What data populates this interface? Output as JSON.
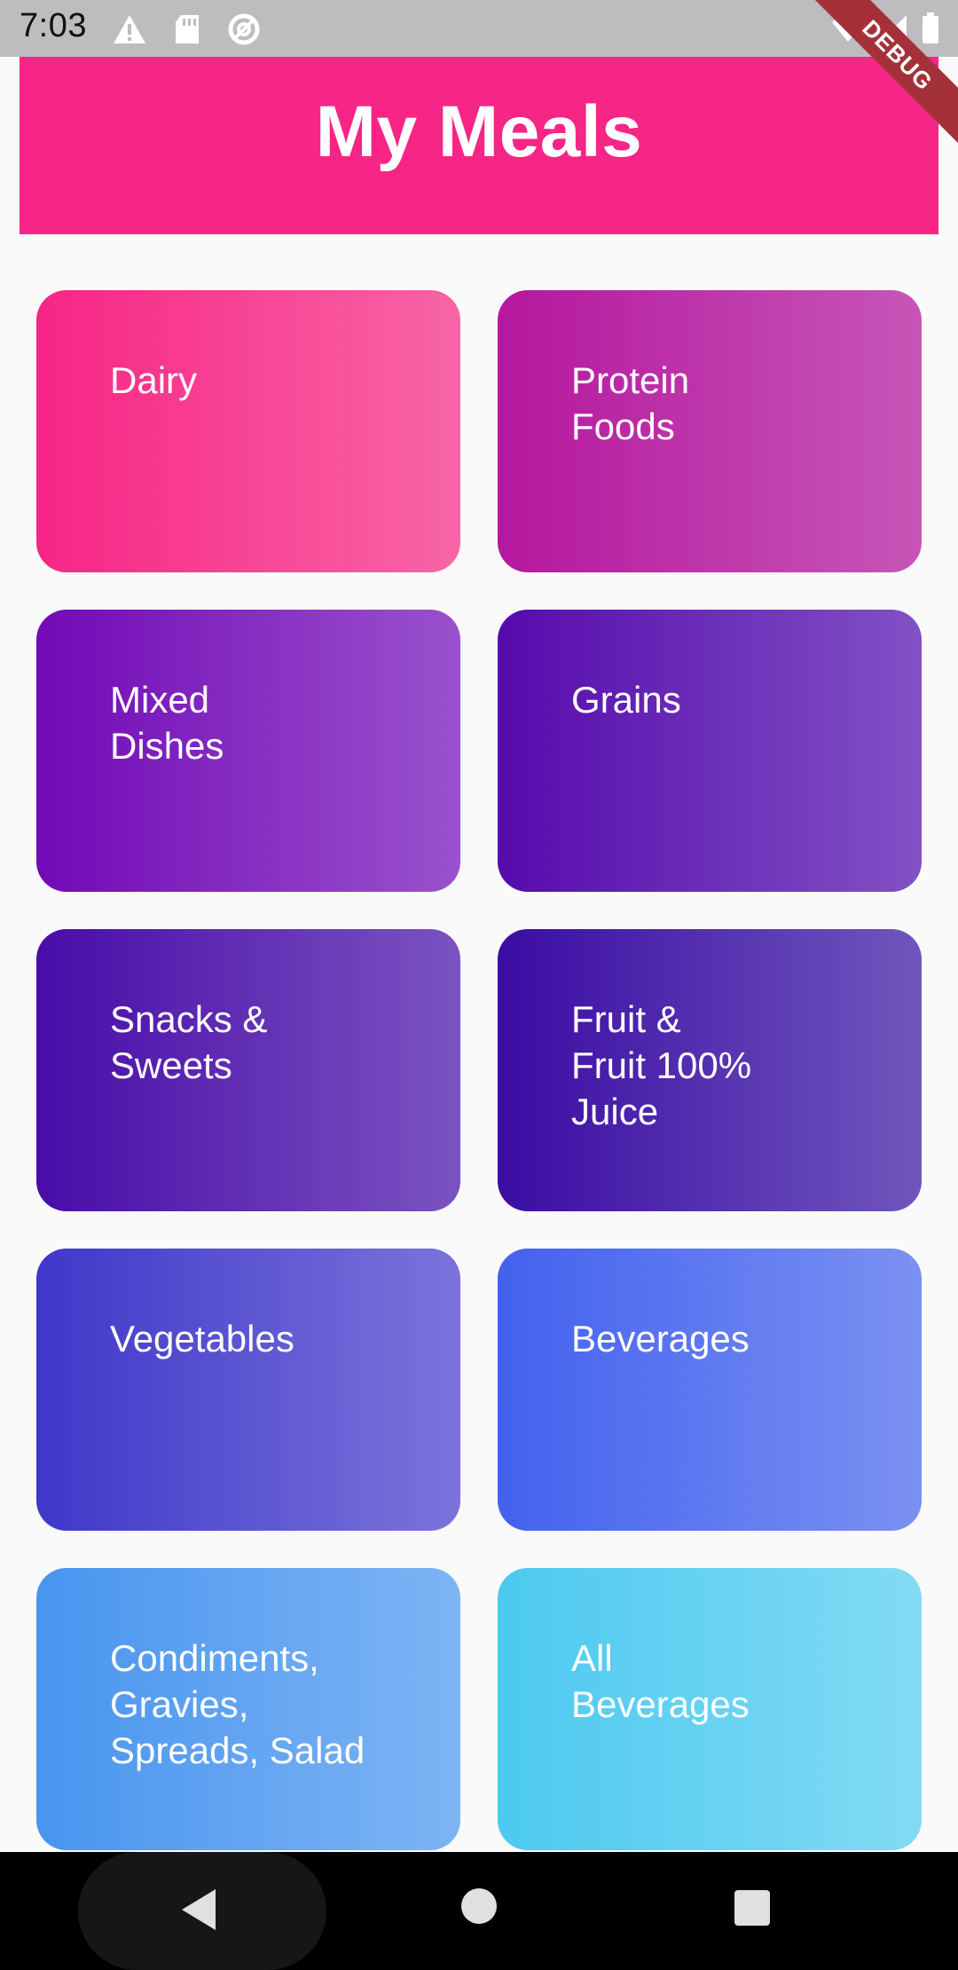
{
  "status_bar": {
    "time": "7:03",
    "icons_left": [
      "warning-icon",
      "sd-card-icon",
      "sync-icon"
    ],
    "icons_right": [
      "wifi-icon",
      "cellular-signal-icon",
      "battery-icon"
    ],
    "debug_banner": "DEBUG"
  },
  "app_bar": {
    "title": "My Meals",
    "color": "#f72585"
  },
  "categories": [
    {
      "label": "Dairy",
      "gradient": [
        "#f72585",
        "#f865a6"
      ]
    },
    {
      "label": "Protein\nFoods",
      "gradient": [
        "#b5179e",
        "#c756b7"
      ]
    },
    {
      "label": "Mixed\nDishes",
      "gradient": [
        "#7209b7",
        "#9a52cd"
      ]
    },
    {
      "label": "Grains",
      "gradient": [
        "#560bad",
        "#8251c5"
      ]
    },
    {
      "label": "Snacks &\nSweets",
      "gradient": [
        "#480ca8",
        "#7b53c0"
      ]
    },
    {
      "label": "Fruit &\nFruit 100%\nJuice",
      "gradient": [
        "#3a0ca3",
        "#7056bd"
      ]
    },
    {
      "label": "Vegetables",
      "gradient": [
        "#3f37c9",
        "#7a74db"
      ]
    },
    {
      "label": "Beverages",
      "gradient": [
        "#4361ee",
        "#7b91f3"
      ]
    },
    {
      "label": "Condiments,\nGravies,\nSpreads, Salad",
      "gradient": [
        "#4895ef",
        "#7eb4f4"
      ]
    },
    {
      "label": "All\nBeverages",
      "gradient": [
        "#4cc9f0",
        "#82dbf4"
      ]
    }
  ],
  "nav_bar": {
    "back": "back-icon",
    "home": "home-icon",
    "recents": "recents-icon"
  }
}
